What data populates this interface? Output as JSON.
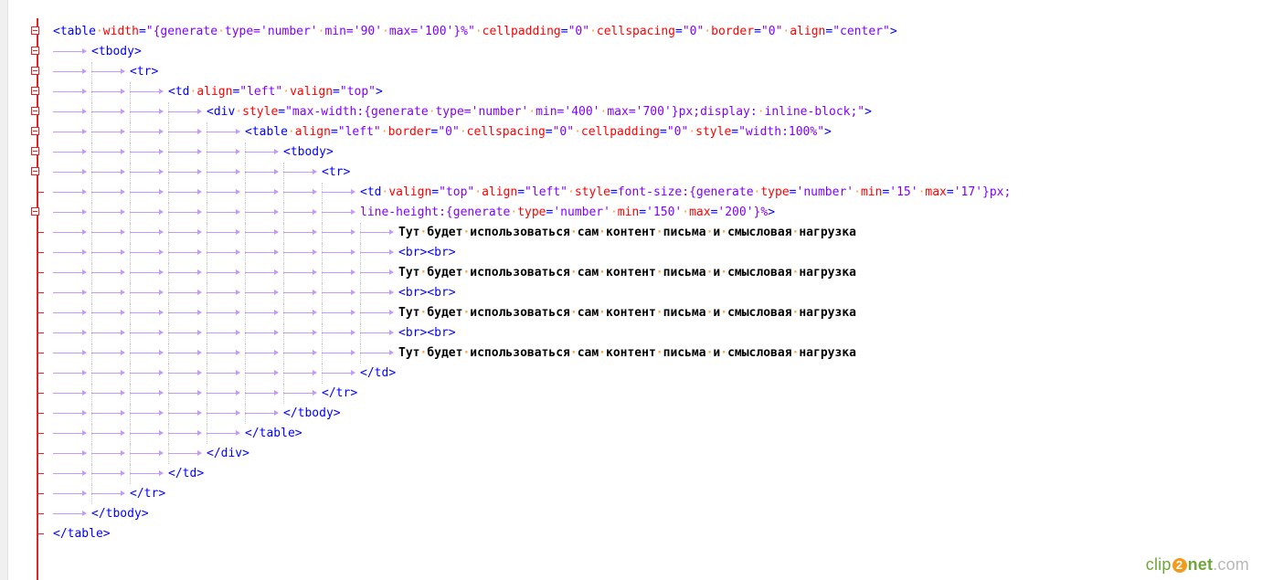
{
  "editor": {
    "lines": [
      {
        "indent": 0,
        "fold": true,
        "text": "<table width=\"{generate type='number' min='90' max='100'}%\" cellpadding=\"0\" cellspacing=\"0\" border=\"0\" align=\"center\">"
      },
      {
        "indent": 1,
        "fold": true,
        "text": "<tbody>"
      },
      {
        "indent": 2,
        "fold": true,
        "text": "<tr>"
      },
      {
        "indent": 3,
        "fold": true,
        "text": "<td align=\"left\" valign=\"top\">"
      },
      {
        "indent": 4,
        "fold": true,
        "text": "<div style=\"max-width:{generate type='number' min='400' max='700'}px;display: inline-block;\">"
      },
      {
        "indent": 5,
        "fold": true,
        "text": "<table align=\"left\" border=\"0\" cellspacing=\"0\" cellpadding=\"0\" style=\"width:100%\">"
      },
      {
        "indent": 6,
        "fold": true,
        "text": "<tbody>"
      },
      {
        "indent": 7,
        "fold": true,
        "text": "<tr>"
      },
      {
        "indent": 8,
        "fold": false,
        "text": "<td valign=\"top\" align=\"left\" style=\"font-size:{generate type='number' min='15' max='17'}px;"
      },
      {
        "indent": 8,
        "fold": true,
        "text": "line-height:{generate type='number' min='150' max='200'}%\">"
      },
      {
        "indent": 9,
        "fold": false,
        "text": "Тут будет использоваться сам контент письма и смысловая нагрузка"
      },
      {
        "indent": 9,
        "fold": false,
        "text": "<br><br>"
      },
      {
        "indent": 9,
        "fold": false,
        "text": "Тут будет использоваться сам контент письма и смысловая нагрузка"
      },
      {
        "indent": 9,
        "fold": false,
        "text": "<br><br>"
      },
      {
        "indent": 9,
        "fold": false,
        "text": "Тут будет использоваться сам контент письма и смысловая нагрузка"
      },
      {
        "indent": 9,
        "fold": false,
        "text": "<br><br>"
      },
      {
        "indent": 9,
        "fold": false,
        "text": "Тут будет использоваться сам контент письма и смысловая нагрузка"
      },
      {
        "indent": 8,
        "fold": false,
        "text": "</td>"
      },
      {
        "indent": 7,
        "fold": false,
        "text": "</tr>"
      },
      {
        "indent": 6,
        "fold": false,
        "text": "</tbody>"
      },
      {
        "indent": 5,
        "fold": false,
        "text": "</table>"
      },
      {
        "indent": 4,
        "fold": false,
        "text": "</div>"
      },
      {
        "indent": 3,
        "fold": false,
        "text": "</td>"
      },
      {
        "indent": 2,
        "fold": false,
        "text": "</tr>"
      },
      {
        "indent": 1,
        "fold": false,
        "text": "</tbody>"
      },
      {
        "indent": 0,
        "fold": false,
        "text": "</table>"
      }
    ]
  },
  "watermark": {
    "part1": "clip",
    "part2": "2",
    "part3": "net",
    ".com": ".com"
  },
  "colors": {
    "tag": "#0000ff",
    "attribute": "#ff0000",
    "string": "#8000ff",
    "text": "#000000",
    "fold_marker": "#e02424",
    "tab_arrow": "#c49bf5",
    "space_dot": "#ff9c3a"
  }
}
